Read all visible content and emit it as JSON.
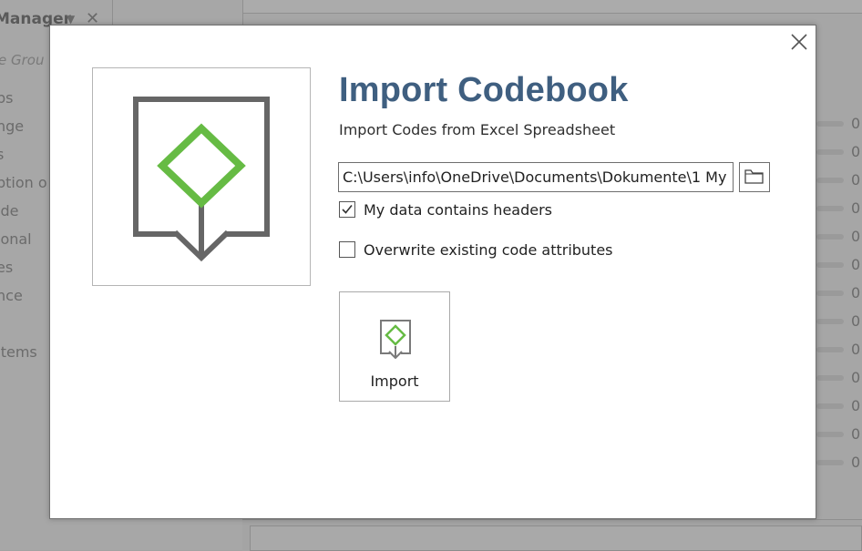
{
  "background": {
    "panel_title": "Manager",
    "search_placeholder": "e Grou",
    "list_items": [
      "ps",
      "nge",
      "s",
      "ption o",
      "ide",
      "ional",
      "es",
      "nce",
      "",
      "Items"
    ],
    "right_values": [
      "0",
      "0",
      "0",
      "0",
      "0",
      "0",
      "0",
      "0",
      "0",
      "0",
      "0",
      "0",
      "0"
    ]
  },
  "dialog": {
    "title": "Import Codebook",
    "subtitle": "Import Codes from Excel Spreadsheet",
    "file_path": "C:\\Users\\info\\OneDrive\\Documents\\Dokumente\\1 My",
    "headers_label": "My data contains headers",
    "headers_checked": true,
    "overwrite_label": "Overwrite existing code attributes",
    "overwrite_checked": false,
    "import_label": "Import",
    "accent_green": "#66bb44",
    "title_color": "#3f5f80",
    "icons": {
      "hero": "import-codebook-icon",
      "close": "close-icon",
      "browse": "folder-icon"
    }
  }
}
